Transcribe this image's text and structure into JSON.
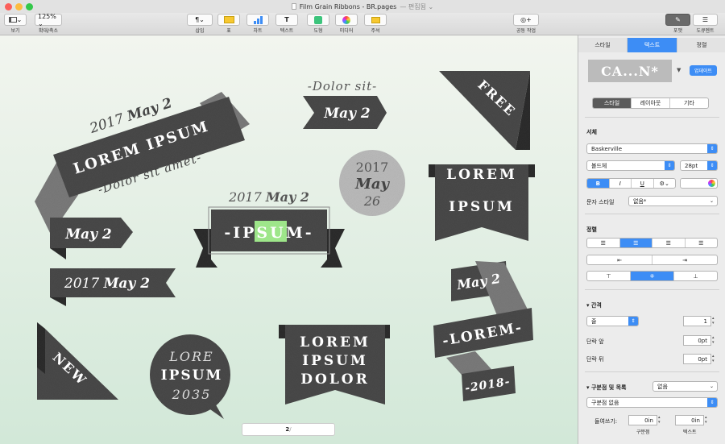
{
  "window": {
    "title": "Film Grain Ribbons - BR.pages",
    "edit_state": "— 편집됨 ⌄"
  },
  "toolbar": {
    "view": "보기",
    "zoom_value": "125% ⌄",
    "zoom": "확대/축소",
    "insert": "삽입",
    "table": "표",
    "chart": "차트",
    "text": "텍스트",
    "shape": "도형",
    "media": "미디어",
    "comment": "주석",
    "collab": "공동 작업",
    "format": "포맷",
    "document": "도큐멘트"
  },
  "canvas": {
    "r1": {
      "l1": "2017",
      "l1b": "May 2",
      "l2": "LOREM IPSUM",
      "l3": "-Dolor sit amet-"
    },
    "r2": {
      "top": "-Dolor sit-",
      "main": "May 2"
    },
    "r3": {
      "main": "FREE"
    },
    "r4": {
      "l1": "2017",
      "l2": "May",
      "l3": "26"
    },
    "r5": {
      "top": "LOREM",
      "bottom": "IPSUM"
    },
    "r6": {
      "top": "2017",
      "topb": "May 2",
      "pre": "-IP",
      "sel": "SU",
      "post": "M-"
    },
    "r7": {
      "main": "May 2"
    },
    "r8": {
      "pre": "2017",
      "main": "May 2"
    },
    "r9": {
      "top": "May 2",
      "mid": "-LOREM-",
      "bot": "-2018-"
    },
    "r10": {
      "main": "NEW"
    },
    "r11": {
      "l1": "LORE",
      "l2": "IPSUM",
      "l3": "2035"
    },
    "r12": {
      "l1": "LOREM",
      "l2": "IPSUM",
      "l3": "DOLOR"
    },
    "page_num": "2",
    "page_suffix": "/"
  },
  "inspector": {
    "tabs": [
      "스타일",
      "텍스트",
      "정렬"
    ],
    "style_preview": "CA...N*",
    "update": "업데이트",
    "subtabs": [
      "스타일",
      "레이아웃",
      "기타"
    ],
    "font_section": "서체",
    "font_name": "Baskerville",
    "font_weight": "볼드체",
    "font_size": "28pt",
    "char_style_label": "문자 스타일",
    "char_style_value": "없음*",
    "align_section": "정렬",
    "spacing_section": "간격",
    "line_label": "줄",
    "line_value": "1",
    "before_label": "단락 앞",
    "before_value": "0pt",
    "after_label": "단락 뒤",
    "after_value": "0pt",
    "bullets_label": "구분점 및 목록",
    "bullets_value": "없음",
    "bullets_style": "구분점 없음",
    "indent_label": "들여쓰기:",
    "indent_bullet": "0in",
    "indent_text": "0in",
    "indent_sub1": "구분점",
    "indent_sub2": "텍스트"
  },
  "colors": {
    "accent": "#3d8df5",
    "ribbon": "#4a4a4a",
    "ribbon_light": "#8a8a8a",
    "canvas_top": "#f2f5ef",
    "canvas_bottom": "#d2e8d8",
    "selection": "#9ee68a"
  }
}
